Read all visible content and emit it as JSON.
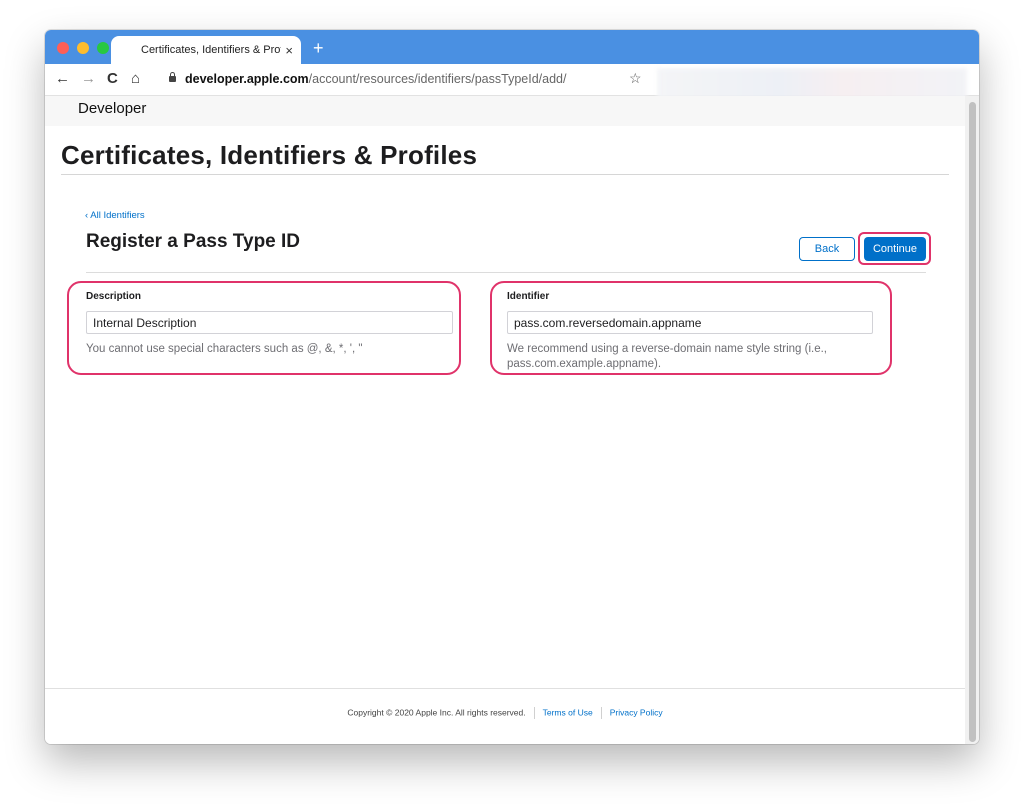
{
  "browser": {
    "tab_title": "Certificates, Identifiers & Profiles",
    "tab_close": "×",
    "new_tab": "+",
    "url_host": "developer.apple.com",
    "url_path": "/account/resources/identifiers/passTypeId/add/",
    "nav": {
      "back": "←",
      "forward": "→",
      "reload": "C",
      "home": "⌂",
      "bookmark": "☆"
    }
  },
  "header": {
    "brand": "Developer",
    "logo": ""
  },
  "page": {
    "title": "Certificates, Identifiers & Profiles",
    "back_link": "‹ All Identifiers",
    "section_title": "Register a Pass Type ID",
    "buttons": {
      "back": "Back",
      "continue": "Continue"
    }
  },
  "form": {
    "description": {
      "label": "Description",
      "value": "Internal Description",
      "help": "You cannot use special characters such as @, &, *, ', \""
    },
    "identifier": {
      "label": "Identifier",
      "value": "pass.com.reversedomain.appname",
      "help": "We recommend using a reverse-domain name style string (i.e., pass.com.example.appname)."
    }
  },
  "footer": {
    "copyright": "Copyright © 2020 Apple Inc. All rights reserved.",
    "terms": "Terms of Use",
    "privacy": "Privacy Policy"
  },
  "colors": {
    "accent": "#0070c9",
    "highlight": "#e0336a",
    "tabbar": "#4a90e2"
  }
}
